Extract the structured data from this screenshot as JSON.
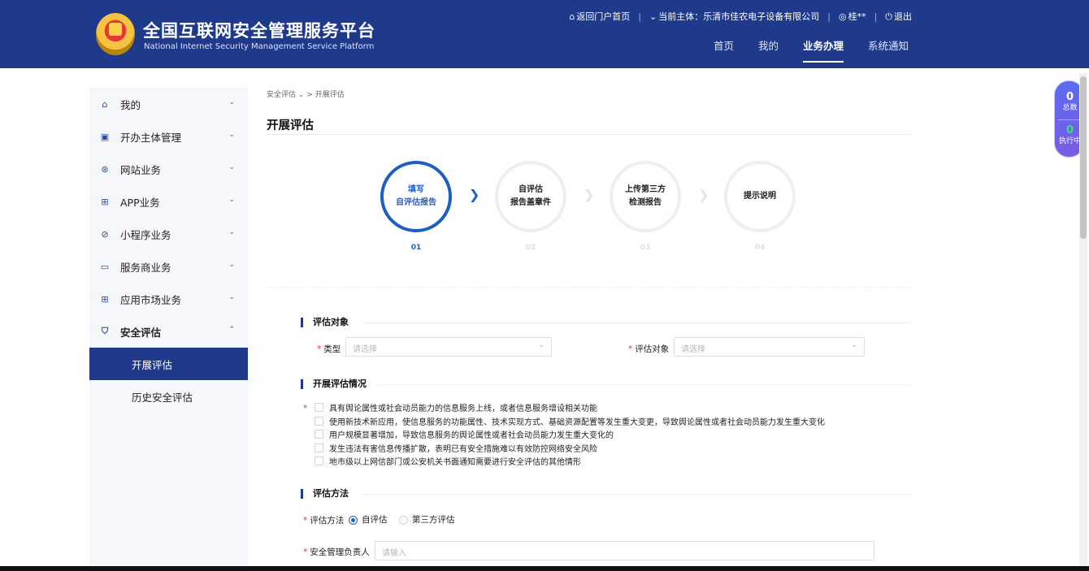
{
  "header": {
    "title": "全国互联网安全管理服务平台",
    "subtitle": "National Internet Security Management Service Platform",
    "top_links": {
      "home_portal": "返回门户首页",
      "entity_label": "当前主体：乐清市佳农电子设备有限公司",
      "user": "桂**",
      "logout": "退出"
    },
    "nav_tabs": [
      "首页",
      "我的",
      "业务办理",
      "系统通知"
    ]
  },
  "sidebar": {
    "items": [
      {
        "label": "我的",
        "icon": "home-icon"
      },
      {
        "label": "开办主体管理",
        "icon": "briefcase-icon"
      },
      {
        "label": "网站业务",
        "icon": "globe-icon"
      },
      {
        "label": "APP业务",
        "icon": "grid-icon"
      },
      {
        "label": "小程序业务",
        "icon": "compass-icon"
      },
      {
        "label": "服务商业务",
        "icon": "monitor-icon"
      },
      {
        "label": "应用市场业务",
        "icon": "grid-icon"
      },
      {
        "label": "安全评估",
        "icon": "shield-icon"
      }
    ],
    "sub_items": [
      "开展评估",
      "历史安全评估"
    ]
  },
  "breadcrumb": {
    "parent": "安全评估",
    "sep": ">",
    "current": "开展评估"
  },
  "page_title": "开展评估",
  "steps": [
    {
      "line1": "填写",
      "line2": "自评估报告",
      "num": "01"
    },
    {
      "line1": "自评估",
      "line2": "报告盖章件",
      "num": "02"
    },
    {
      "line1": "上传第三方",
      "line2": "检测报告",
      "num": "03"
    },
    {
      "line1": "提示说明",
      "line2": "",
      "num": "04"
    }
  ],
  "section_target": {
    "title": "评估对象",
    "type_label": "类型",
    "type_placeholder": "请选择",
    "target_label": "评估对象",
    "target_placeholder": "请选择"
  },
  "section_situation": {
    "title": "开展评估情况",
    "options": [
      "具有舆论属性或社会动员能力的信息服务上线，或者信息服务增设相关功能",
      "使用新技术新应用，使信息服务的功能属性、技术实现方式、基础资源配置等发生重大变更，导致舆论属性或者社会动员能力发生重大变化",
      "用户规模显著增加，导致信息服务的舆论属性或者社会动员能力发生重大变化的",
      "发生违法有害信息传播扩散，表明已有安全措施难以有效防控网络安全风险",
      "地市级以上网信部门或公安机关书面通知需要进行安全评估的其他情形"
    ]
  },
  "section_method": {
    "title": "评估方法",
    "method_label": "评估方法",
    "options": [
      "自评估",
      "第三方评估"
    ],
    "selected": "自评估",
    "manager_label": "安全管理负责人",
    "manager_placeholder": "请输入"
  },
  "float_stats": [
    {
      "num": "0",
      "label": "总数"
    },
    {
      "num": "0",
      "label": "执行中"
    }
  ],
  "colors": {
    "primary": "#1f3a8a",
    "accent": "#1f5fc4",
    "required": "#e23b3b"
  }
}
